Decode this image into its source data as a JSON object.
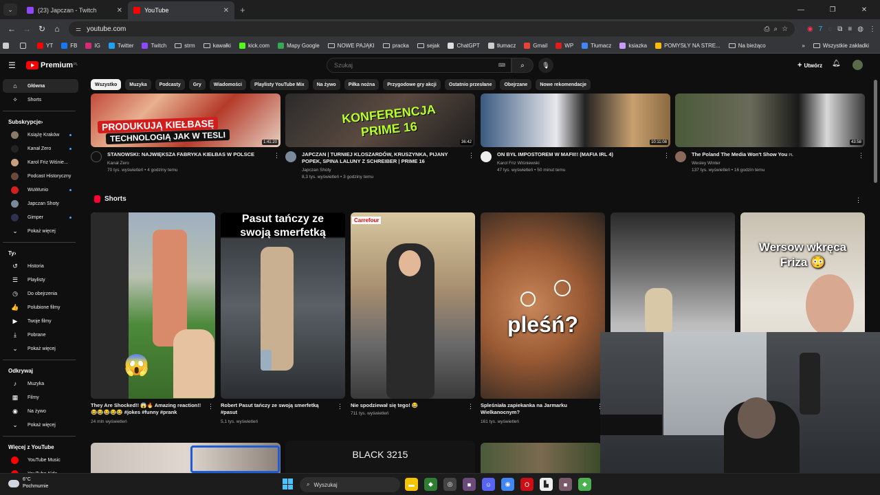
{
  "browser": {
    "tabs": [
      {
        "title": "(23) Japczan - Twitch",
        "color": "#9146ff"
      },
      {
        "title": "YouTube",
        "color": "#ff0000"
      }
    ],
    "url": "youtube.com",
    "bookmarks": [
      {
        "label": "YT",
        "color": "#ff0000"
      },
      {
        "label": "FB",
        "color": "#1877f2"
      },
      {
        "label": "IG",
        "color": "#d62976"
      },
      {
        "label": "Twitter",
        "color": "#1da1f2"
      },
      {
        "label": "Twitch",
        "color": "#9146ff"
      },
      {
        "label": "strm",
        "folder": true
      },
      {
        "label": "kawałki",
        "folder": true
      },
      {
        "label": "kick.com",
        "color": "#53fc18"
      },
      {
        "label": "Mapy Google",
        "color": "#34a853"
      },
      {
        "label": "NOWE PAJĄKI",
        "folder": true
      },
      {
        "label": "pracka",
        "folder": true
      },
      {
        "label": "sejak",
        "folder": true
      },
      {
        "label": "ChatGPT",
        "color": "#dddddd"
      },
      {
        "label": "tłumacz",
        "color": "#cccccc"
      },
      {
        "label": "Gmail",
        "color": "#ea4335"
      },
      {
        "label": "WP",
        "color": "#e21b1b"
      },
      {
        "label": "Tłumacz",
        "color": "#4285f4"
      },
      {
        "label": "ksiazka",
        "color": "#c99bff"
      },
      {
        "label": "POMYSŁY NA STRE...",
        "color": "#fbbc04"
      },
      {
        "label": "Na bieżąco",
        "folder": true
      }
    ],
    "all_bookmarks": "Wszystkie zakładki"
  },
  "youtube": {
    "logo": "Premium",
    "logo_region": "PL",
    "search_placeholder": "Szukaj",
    "create_label": "Utwórz",
    "chips": [
      "Wszystko",
      "Muzyka",
      "Podcasty",
      "Gry",
      "Wiadomości",
      "Playlisty YouTube Mix",
      "Na żywo",
      "Piłka nożna",
      "Przygodowe gry akcji",
      "Ostatnio przesłane",
      "Obejrzane",
      "Nowe rekomendacje"
    ],
    "sidebar": {
      "main": [
        {
          "label": "Główna",
          "icon": "home-icon",
          "glyph": "⌂"
        },
        {
          "label": "Shorts",
          "icon": "shorts-icon",
          "glyph": "✧"
        }
      ],
      "subs_heading": "Subskrypcje",
      "subs": [
        {
          "label": "Książę Kraków",
          "color": "#8a7a6a"
        },
        {
          "label": "Kanał Zero",
          "color": "#222222"
        },
        {
          "label": "Karol Friz Wiśnie...",
          "color": "#c8a080"
        },
        {
          "label": "Podcast Historyczny",
          "color": "#6a4a3a"
        },
        {
          "label": "WuWunio",
          "color": "#d02020"
        },
        {
          "label": "Japczan Shoty",
          "color": "#7a8a9a"
        },
        {
          "label": "Gimper",
          "color": "#303050"
        }
      ],
      "show_more": "Pokaż więcej",
      "you_heading": "Ty",
      "you": [
        {
          "label": "Historia",
          "glyph": "↺"
        },
        {
          "label": "Playlisty",
          "glyph": "☰"
        },
        {
          "label": "Do obejrzenia",
          "glyph": "◷"
        },
        {
          "label": "Polubione filmy",
          "glyph": "👍"
        },
        {
          "label": "Twoje filmy",
          "glyph": "▶"
        },
        {
          "label": "Pobrane",
          "glyph": "⤓"
        },
        {
          "label": "Pokaż więcej",
          "glyph": "⌄"
        }
      ],
      "explore_heading": "Odkrywaj",
      "explore": [
        {
          "label": "Muzyka",
          "glyph": "♪"
        },
        {
          "label": "Filmy",
          "glyph": "▦"
        },
        {
          "label": "Na żywo",
          "glyph": "◉"
        },
        {
          "label": "Pokaż więcej",
          "glyph": "⌄"
        }
      ],
      "more_heading": "Więcej z YouTube",
      "more": [
        {
          "label": "YouTube Music",
          "color": "#ff0000"
        },
        {
          "label": "YouTube Kids",
          "color": "#ff0000"
        }
      ]
    },
    "videos": [
      {
        "title": "STANOWSKI: NAJWIĘKSZA FABRYKA KIEŁBAS W POLSCE",
        "channel": "Kanał Zero",
        "views": "70 tys. wyświetleń • 4 godziny temu",
        "duration": "1:41:20",
        "overlay1": "PRODUKUJĄ KIEŁBASĘ",
        "overlay2": "TECHNOLOGIĄ JAK W TESLI"
      },
      {
        "title": "JAPCZAN | TURNIEJ KLOSZARDÓW, KRUSZYNKA, PIJANY POPEK, SPINA LALUNY Z SCHREIBER | PRIME 16",
        "channel": "Japczan Shoty",
        "views": "8,3 tys. wyświetleń • 3 godziny temu",
        "duration": "36:42",
        "overlay1": "KONFERENCJA",
        "overlay2": "PRIME 16"
      },
      {
        "title": "ON BYŁ IMPOSTOREM W MAFII!! (MAFIA IRL 4)",
        "channel": "Karol Friz Wiśniewski",
        "views": "47 tys. wyświetleń • 50 minut temu",
        "duration": "10:11:08"
      },
      {
        "title": "The Poland The Media Won't Show You",
        "title_badge": "PL",
        "channel": "Wesley Winter",
        "views": "137 tys. wyświetleń • 16 godzin temu",
        "duration": "43:58"
      }
    ],
    "shorts_heading": "Shorts",
    "shorts": [
      {
        "title": "They Are Shocked!! 😱🔥 Amazing reaction!! 😂😂😂😂😂 #jokes #funny #prank",
        "views": "24 mln wyświetleń"
      },
      {
        "title": "Robert Pasut tańczy ze swoją smerfetką #pasut",
        "views": "5,1 tys. wyświetleń",
        "overlay": "Pasut tańczy ze swoją smerfetką"
      },
      {
        "title": "Nie spodziewał się tego! 😂",
        "views": "711 tys. wyświetleń",
        "sign": "Carrefour"
      },
      {
        "title": "Spleśniała zapiekanka na Jarmarku Wielkanocnym?",
        "views": "161 tys. wyświetleń",
        "overlay": "pleśń?"
      },
      {
        "title": "",
        "views": ""
      },
      {
        "title": "",
        "views": "",
        "overlay": "Wersow wkręca Friza 😳"
      }
    ],
    "bottom_row_text": "BLACK 3215"
  },
  "taskbar": {
    "weather_temp": "6°C",
    "weather_desc": "Pochmurnie",
    "search": "Wyszukaj",
    "apps": [
      {
        "name": "file-explorer-icon",
        "color": "#f5c400",
        "glyph": "▬"
      },
      {
        "name": "shield-app-icon",
        "color": "#2e7d32",
        "glyph": "◆"
      },
      {
        "name": "app-icon",
        "color": "#444444",
        "glyph": "◎"
      },
      {
        "name": "app-icon",
        "color": "#6a4a7a",
        "glyph": "■"
      },
      {
        "name": "discord-icon",
        "color": "#5865f2",
        "glyph": "☺"
      },
      {
        "name": "chrome-icon",
        "color": "#4285f4",
        "glyph": "◉"
      },
      {
        "name": "opera-icon",
        "color": "#cc0f16",
        "glyph": "O"
      },
      {
        "name": "app-icon",
        "color": "#eeeeee",
        "glyph": "▙"
      },
      {
        "name": "app-icon",
        "color": "#7a5a6a",
        "glyph": "■"
      },
      {
        "name": "app-icon",
        "color": "#4caf50",
        "glyph": "◆"
      }
    ]
  }
}
